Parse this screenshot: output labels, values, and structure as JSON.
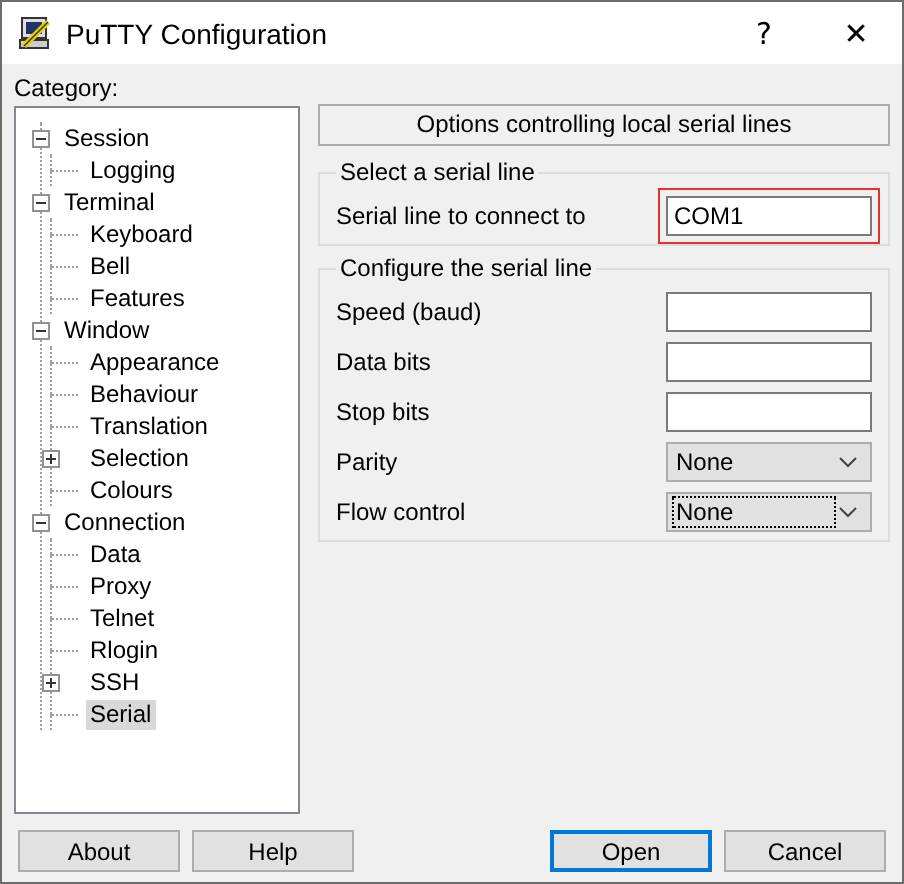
{
  "window": {
    "title": "PuTTY Configuration",
    "help_button": "?",
    "close_button": "✕"
  },
  "category_label": "Category:",
  "tree": [
    {
      "label": "Session",
      "expanded": true,
      "selected": false,
      "children": [
        {
          "label": "Logging",
          "selected": false
        }
      ]
    },
    {
      "label": "Terminal",
      "expanded": true,
      "selected": false,
      "children": [
        {
          "label": "Keyboard",
          "selected": false
        },
        {
          "label": "Bell",
          "selected": false
        },
        {
          "label": "Features",
          "selected": false
        }
      ]
    },
    {
      "label": "Window",
      "expanded": true,
      "selected": false,
      "children": [
        {
          "label": "Appearance",
          "selected": false
        },
        {
          "label": "Behaviour",
          "selected": false
        },
        {
          "label": "Translation",
          "selected": false
        },
        {
          "label": "Selection",
          "expanded": false,
          "selected": false
        },
        {
          "label": "Colours",
          "selected": false
        }
      ]
    },
    {
      "label": "Connection",
      "expanded": true,
      "selected": false,
      "children": [
        {
          "label": "Data",
          "selected": false
        },
        {
          "label": "Proxy",
          "selected": false
        },
        {
          "label": "Telnet",
          "selected": false
        },
        {
          "label": "Rlogin",
          "selected": false
        },
        {
          "label": "SSH",
          "expanded": false,
          "selected": false
        },
        {
          "label": "Serial",
          "selected": true
        }
      ]
    }
  ],
  "panel": {
    "header": "Options controlling local serial lines",
    "groups": [
      {
        "title": "Select a serial line",
        "rows": [
          {
            "kind": "text",
            "label": "Serial line to connect to",
            "value": "COM1",
            "highlighted": true
          }
        ]
      },
      {
        "title": "Configure the serial line",
        "rows": [
          {
            "kind": "text",
            "label": "Speed (baud)",
            "highlighted": false
          },
          {
            "kind": "text",
            "label": "Data bits",
            "highlighted": false
          },
          {
            "kind": "text",
            "label": "Stop bits",
            "highlighted": false
          },
          {
            "kind": "select",
            "label": "Parity",
            "value": "None",
            "focused": false
          },
          {
            "kind": "select",
            "label": "Flow control",
            "value": "None",
            "focused": true
          }
        ]
      }
    ]
  },
  "buttons": [
    {
      "label": "About",
      "default": false
    },
    {
      "label": "Help",
      "default": false
    },
    {
      "label": "Open",
      "default": true
    },
    {
      "label": "Cancel",
      "default": false
    }
  ]
}
